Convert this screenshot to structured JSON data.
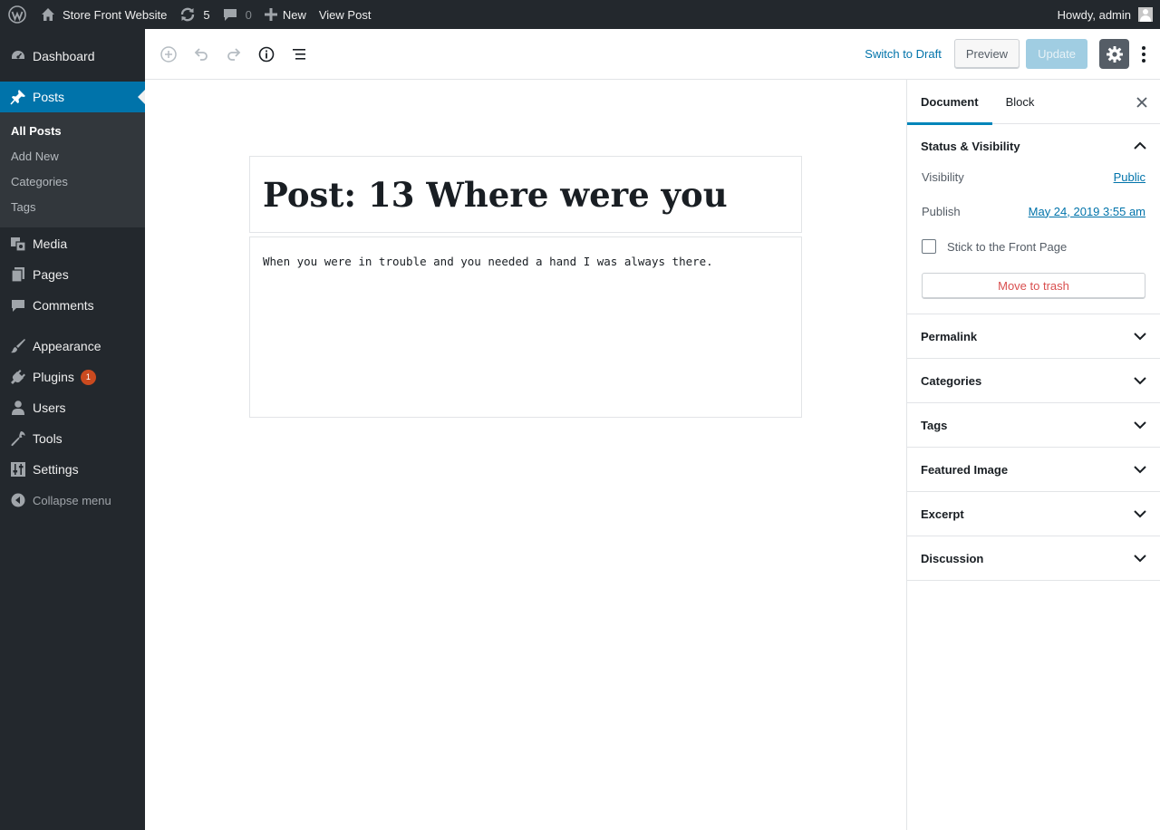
{
  "adminbar": {
    "site_name": "Store Front Website",
    "updates_count": "5",
    "comments_count": "0",
    "new_label": "New",
    "view_post_label": "View Post",
    "howdy": "Howdy, admin"
  },
  "sidebar": {
    "dashboard": "Dashboard",
    "posts": "Posts",
    "posts_sub": [
      "All Posts",
      "Add New",
      "Categories",
      "Tags"
    ],
    "media": "Media",
    "pages": "Pages",
    "comments": "Comments",
    "appearance": "Appearance",
    "plugins": "Plugins",
    "plugins_badge": "1",
    "users": "Users",
    "tools": "Tools",
    "settings": "Settings",
    "collapse": "Collapse menu"
  },
  "header": {
    "switch_to_draft": "Switch to Draft",
    "preview": "Preview",
    "update": "Update"
  },
  "post": {
    "title": "Post: 13 Where were you",
    "paragraph": "When you were in trouble and you needed a hand I was always there."
  },
  "settings": {
    "tab_document": "Document",
    "tab_block": "Block",
    "status_visibility": "Status & Visibility",
    "visibility_label": "Visibility",
    "visibility_value": "Public",
    "publish_label": "Publish",
    "publish_value": "May 24, 2019 3:55 am",
    "stick_label": "Stick to the Front Page",
    "trash": "Move to trash",
    "panels": [
      "Permalink",
      "Categories",
      "Tags",
      "Featured Image",
      "Excerpt",
      "Discussion"
    ]
  },
  "colors": {
    "admin_dark": "#23282d",
    "accent": "#0073aa",
    "update_disabled": "#a0cde2",
    "badge": "#ca4a1f",
    "trash_red": "#d94f4f"
  }
}
